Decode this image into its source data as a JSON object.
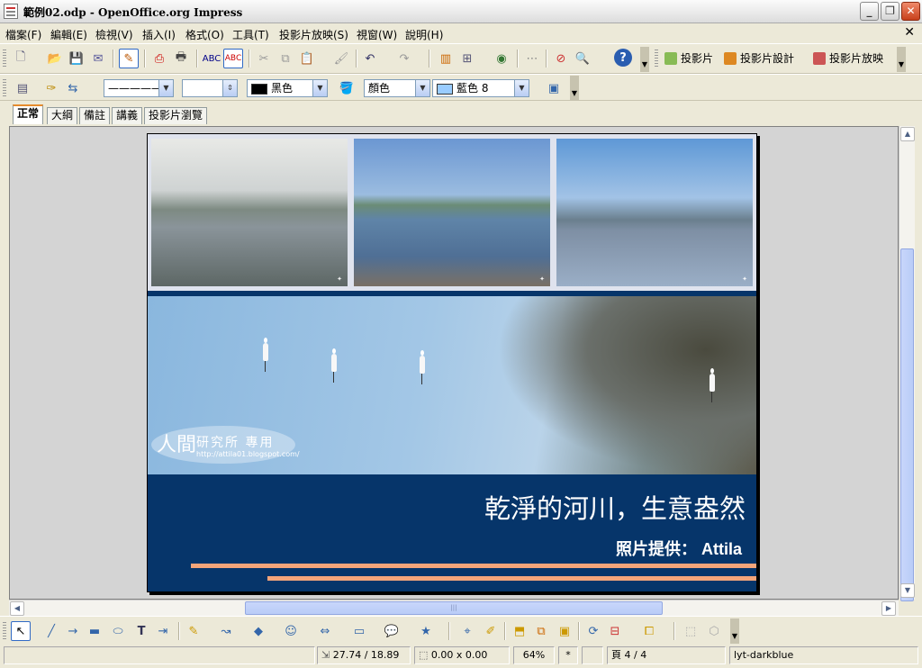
{
  "window": {
    "title": "範例02.odp - OpenOffice.org Impress"
  },
  "menu": [
    "檔案(F)",
    "編輯(E)",
    "檢視(V)",
    "插入(I)",
    "格式(O)",
    "工具(T)",
    "投影片放映(S)",
    "視窗(W)",
    "說明(H)"
  ],
  "standard_toolbar": {
    "slide_button": "投影片",
    "slide_design_button": "投影片設計",
    "slideshow_button": "投影片放映"
  },
  "line_fill_toolbar": {
    "line_style": "———————",
    "line_width": "",
    "line_color": "黑色",
    "line_color_hex": "#000000",
    "area_style": "顏色",
    "fill_color": "藍色 8",
    "fill_color_hex": "#99ccff"
  },
  "view_tabs": [
    "正常",
    "大綱",
    "備註",
    "講義",
    "投影片瀏覽"
  ],
  "slide": {
    "title": "乾淨的河川，生意盎然",
    "credit": "照片提供： Attila",
    "watermark_big": "人間",
    "watermark_mid": "研究所 專用",
    "watermark_url": "http://attila01.blogspot.com/",
    "colors": {
      "background": "#06356a",
      "accent_line": "#f4a57a"
    }
  },
  "status": {
    "position": "27.74 / 18.89",
    "size": "0.00 x 0.00",
    "zoom": "64%",
    "modified": "*",
    "page": "頁 4 / 4",
    "layout": "lyt-darkblue"
  }
}
